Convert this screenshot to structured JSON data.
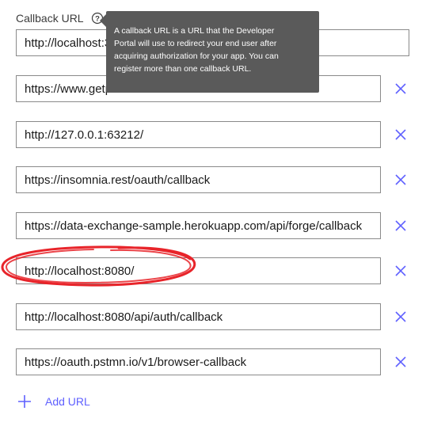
{
  "field": {
    "label": "Callback URL",
    "help_icon": "question-circle-icon",
    "tooltip_lines": [
      "A callback URL is a URL that the Developer",
      "Portal will use to redirect your end user after",
      "acquiring authorization for your app. You can",
      "register more than one callback URL."
    ]
  },
  "urls": [
    "http://localhost:3000/api/oauth/callback",
    "https://www.getpostman.com/oauth2/callback",
    "http://127.0.0.1:63212/",
    "https://insomnia.rest/oauth/callback",
    "https://data-exchange-sample.herokuapp.com/api/forge/callback",
    "http://localhost:8080/",
    "http://localhost:8080/api/auth/callback",
    "https://oauth.pstmn.io/v1/browser-callback"
  ],
  "remove_icon": "close-x-icon",
  "add_url": {
    "label": "Add URL",
    "icon": "plus-icon"
  },
  "colors": {
    "accent": "#5f60ff",
    "tooltip_bg": "#5a5a5a",
    "annotation": "#e8242a",
    "border": "#8a8a8a"
  }
}
